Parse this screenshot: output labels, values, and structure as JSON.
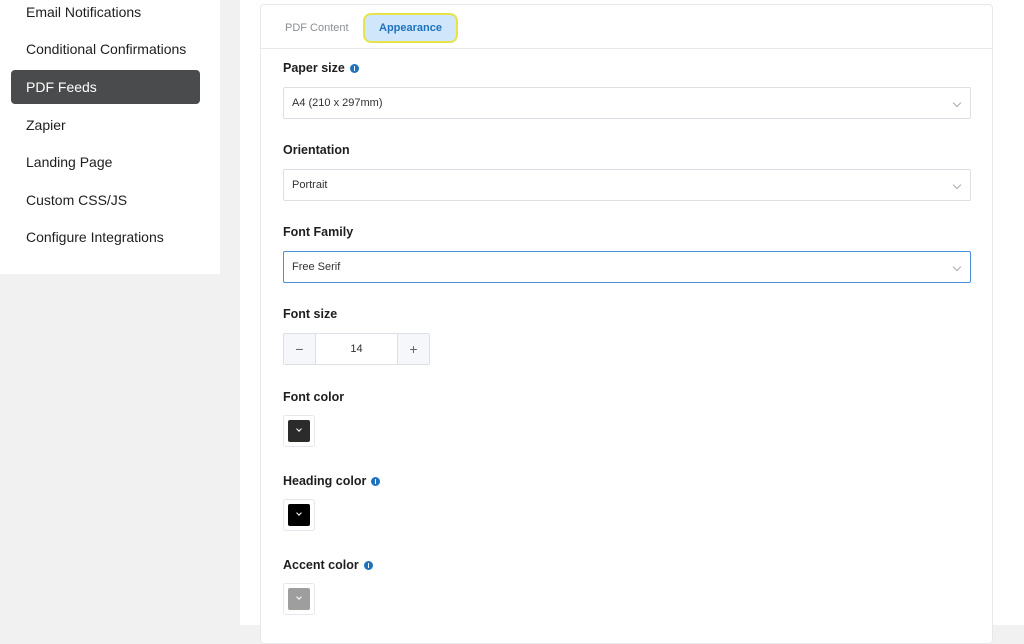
{
  "sidebar": {
    "items": [
      {
        "label": "Email Notifications"
      },
      {
        "label": "Conditional Confirmations"
      },
      {
        "label": "PDF Feeds"
      },
      {
        "label": "Zapier"
      },
      {
        "label": "Landing Page"
      },
      {
        "label": "Custom CSS/JS"
      },
      {
        "label": "Configure Integrations"
      }
    ],
    "active_index": 2
  },
  "tabs": {
    "pdf_content": "PDF Content",
    "appearance": "Appearance",
    "active": "Appearance"
  },
  "form": {
    "paper_size": {
      "label": "Paper size",
      "value": "A4 (210 x 297mm)",
      "has_info": true
    },
    "orientation": {
      "label": "Orientation",
      "value": "Portrait"
    },
    "font_family": {
      "label": "Font Family",
      "value": "Free Serif"
    },
    "font_size": {
      "label": "Font size",
      "value": "14",
      "minus": "−",
      "plus": "+"
    },
    "font_color": {
      "label": "Font color",
      "color": "#2b2b2b"
    },
    "heading_color": {
      "label": "Heading color",
      "color": "#000000",
      "has_info": true
    },
    "accent_color": {
      "label": "Accent color",
      "color": "#9e9e9e",
      "has_info": true
    }
  },
  "colors": {
    "accent": "#1e73be",
    "active_sidebar": "#4a4b4c",
    "tab_highlight_border": "#e7e44a"
  }
}
